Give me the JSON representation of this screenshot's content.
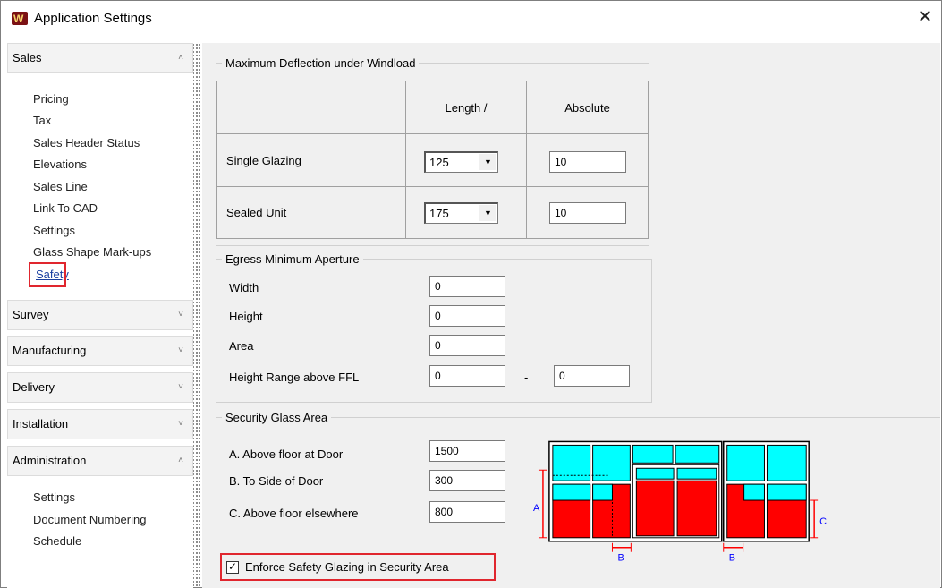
{
  "window": {
    "title": "Application Settings",
    "close_glyph": "✕",
    "logo": "W"
  },
  "sidebar": {
    "sales": {
      "label": "Sales",
      "items": [
        "Pricing",
        "Tax",
        "Sales Header Status",
        "Elevations",
        "Sales Line",
        "Link To CAD",
        "Settings",
        "Glass Shape Mark-ups",
        "Safety"
      ]
    },
    "survey": {
      "label": "Survey"
    },
    "manufacturing": {
      "label": "Manufacturing"
    },
    "delivery": {
      "label": "Delivery"
    },
    "installation": {
      "label": "Installation"
    },
    "administration": {
      "label": "Administration",
      "items": [
        "Settings",
        "Document Numbering",
        "Schedule"
      ]
    },
    "chevron_up": "˄",
    "chevron_down": "˅"
  },
  "deflection": {
    "legend": "Maximum Deflection under Windload",
    "col_length": "Length /",
    "col_absolute": "Absolute",
    "single_label": "Single Glazing",
    "single_length": "125",
    "single_absolute": "10",
    "sealed_label": "Sealed Unit",
    "sealed_length": "175",
    "sealed_absolute": "10"
  },
  "egress": {
    "legend": "Egress Minimum Aperture",
    "width_label": "Width",
    "width_value": "0",
    "height_label": "Height",
    "height_value": "0",
    "area_label": "Area",
    "area_value": "0",
    "range_label": "Height Range above FFL",
    "range_from": "0",
    "range_sep": "-",
    "range_to": "0"
  },
  "security": {
    "legend": "Security Glass Area",
    "a_label": "A. Above floor at Door",
    "a_value": "1500",
    "b_label": "B. To Side of Door",
    "b_value": "300",
    "c_label": "C. Above floor elsewhere",
    "c_value": "800",
    "enforce_label": "Enforce Safety Glazing in Security Area",
    "enforce_checked": true,
    "check_glyph": "✓",
    "diagram_labels": {
      "a": "A",
      "b": "B",
      "c": "C"
    }
  },
  "colors": {
    "glass": "#00ffff",
    "security": "#ff0000",
    "highlight": "#e0262e",
    "dimension": "#0000ff"
  }
}
